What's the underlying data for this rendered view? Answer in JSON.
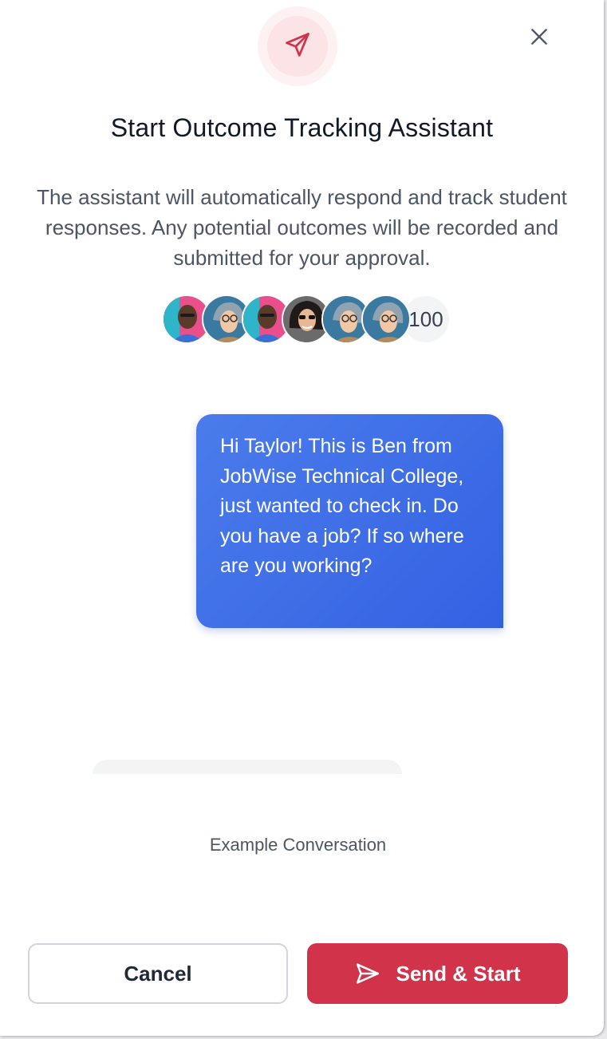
{
  "dialog": {
    "title": "Start Outcome Tracking Assistant",
    "description": "The assistant will automatically respond and track student responses. Any potential outcomes will be recorded and submitted for your approval.",
    "hero_icon": "paper-plane-icon",
    "close_icon": "close-icon"
  },
  "recipients": {
    "avatars": [
      "student-avatar-1",
      "student-avatar-2",
      "student-avatar-3",
      "student-avatar-4",
      "student-avatar-5",
      "student-avatar-6"
    ],
    "count": "100"
  },
  "example": {
    "message": "Hi Taylor! This is Ben from JobWise Technical College, just wanted to check in. Do you have a job? If so where are you working?",
    "caption": "Example Conversation"
  },
  "actions": {
    "cancel_label": "Cancel",
    "send_label": "Send & Start",
    "send_icon": "paper-plane-icon"
  },
  "colors": {
    "accent_red": "#d1334b",
    "bubble_blue": "#3d6ae6",
    "hero_bg": "#fbe3e6"
  }
}
